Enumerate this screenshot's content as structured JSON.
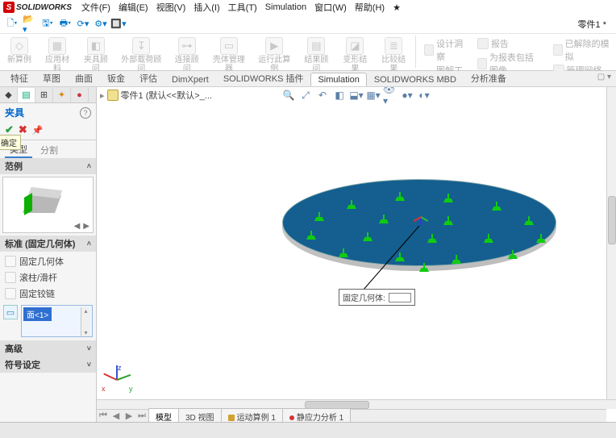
{
  "app": {
    "brand": "SOLIDWORKS"
  },
  "menu": {
    "file": "文件(F)",
    "edit": "编辑(E)",
    "view": "视图(V)",
    "insert": "插入(I)",
    "tools": "工具(T)",
    "simulation": "Simulation",
    "window": "窗口(W)",
    "help": "帮助(H)"
  },
  "title_doc": "零件1 *",
  "ribbon": {
    "groups": [
      {
        "label": "新算例",
        "sub": "▾"
      },
      {
        "label": "应用材料"
      },
      {
        "label": "夹具顾问"
      },
      {
        "label": "外部载荷顾问"
      },
      {
        "label": "连接顾问"
      },
      {
        "label": "壳体管理器"
      },
      {
        "label": "运行此算例"
      },
      {
        "label": "结果顾问"
      },
      {
        "label": "变形结果"
      },
      {
        "label": "比较结果"
      }
    ],
    "right": [
      {
        "label": "设计洞察"
      },
      {
        "label": "图解工具"
      },
      {
        "label": "报告"
      },
      {
        "label": "为报表包括图像"
      },
      {
        "label": "已解除的模拟"
      },
      {
        "label": "管理网络"
      }
    ]
  },
  "cmd_tabs": [
    "特征",
    "草图",
    "曲面",
    "钣金",
    "评估",
    "DimXpert",
    "SOLIDWORKS 插件",
    "Simulation",
    "SOLIDWORKS MBD",
    "分析准备"
  ],
  "cmd_tabs_active": 7,
  "pm": {
    "title": "夹具",
    "tooltip": "确定",
    "section_example": "范例",
    "section_std": "标准 (固定几何体)",
    "std_items": [
      "固定几何体",
      "滚柱/滑杆",
      "固定铰链"
    ],
    "selection_item": "面<1>",
    "section_adv": "高级",
    "section_sym": "符号设定"
  },
  "viewport": {
    "breadcrumb": "零件1 (默认<<默认>_...",
    "callout_label": "固定几何体:"
  },
  "bottom_tabs": {
    "model": "模型",
    "view3d": "3D 视图",
    "motion": "运动算例 1",
    "static": "静应力分析 1"
  }
}
